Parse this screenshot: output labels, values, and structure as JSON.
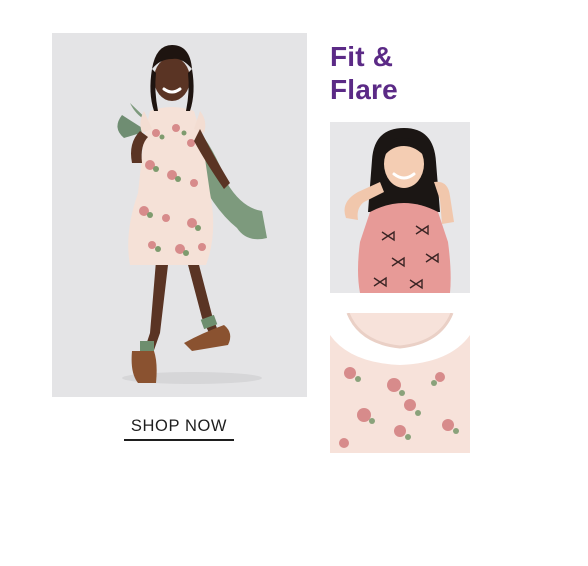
{
  "headline": {
    "line1": "Fit &",
    "line2": "Flare"
  },
  "cta": {
    "label": "SHOP NOW"
  },
  "colors": {
    "headline": "#5b2a86",
    "cta_text": "#1e1e1e",
    "hero_background": "#e4e4e6"
  },
  "images": {
    "hero": "girl-floral-dress-photo",
    "thumb_top": "girl-pink-bow-dress-photo",
    "thumb_bottom": "floral-dress-neckline-detail-photo"
  }
}
